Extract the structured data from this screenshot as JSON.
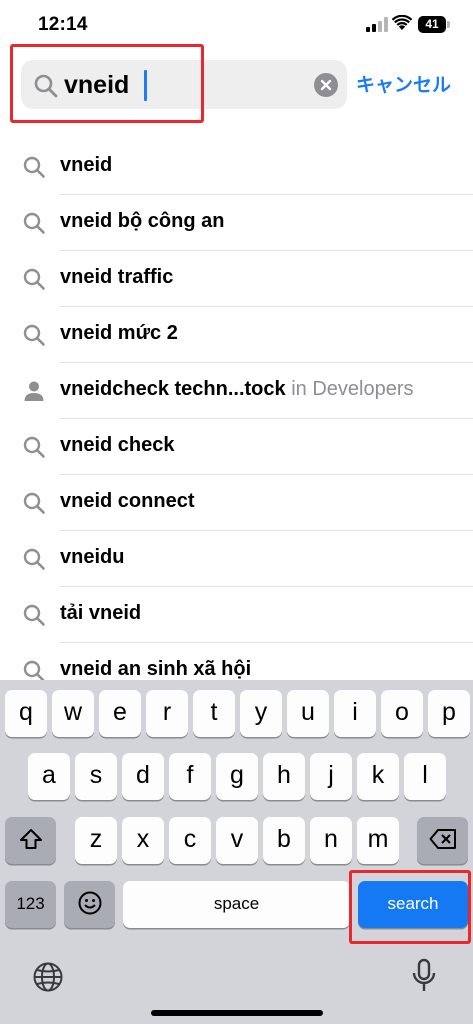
{
  "status_bar": {
    "time": "12:14",
    "battery": "41",
    "icons": [
      "signal-icon",
      "wifi-icon",
      "battery-icon"
    ]
  },
  "search": {
    "value": "vneid",
    "cancel_label": "キャンセル",
    "clear_icon": "clear-icon",
    "search_icon": "search-icon"
  },
  "suggestions": [
    {
      "icon": "search-icon",
      "text": "vneid",
      "suffix": ""
    },
    {
      "icon": "search-icon",
      "text": "vneid bộ công an",
      "suffix": ""
    },
    {
      "icon": "search-icon",
      "text": "vneid traffic",
      "suffix": ""
    },
    {
      "icon": "search-icon",
      "text": "vneid mức 2",
      "suffix": ""
    },
    {
      "icon": "person-icon",
      "text": "vneidcheck techn...tock",
      "suffix": " in Developers"
    },
    {
      "icon": "search-icon",
      "text": "vneid check",
      "suffix": ""
    },
    {
      "icon": "search-icon",
      "text": "vneid connect",
      "suffix": ""
    },
    {
      "icon": "search-icon",
      "text": "vneidu",
      "suffix": ""
    },
    {
      "icon": "search-icon",
      "text": "tải vneid",
      "suffix": ""
    },
    {
      "icon": "search-icon",
      "text": "vneid an sinh xã hội",
      "suffix": ""
    }
  ],
  "keyboard": {
    "row1": [
      "q",
      "w",
      "e",
      "r",
      "t",
      "y",
      "u",
      "i",
      "o",
      "p"
    ],
    "row2": [
      "a",
      "s",
      "d",
      "f",
      "g",
      "h",
      "j",
      "k",
      "l"
    ],
    "row3": [
      "z",
      "x",
      "c",
      "v",
      "b",
      "n",
      "m"
    ],
    "numbers_label": "123",
    "space_label": "space",
    "search_label": "search",
    "icons": [
      "shift-icon",
      "delete-icon",
      "emoji-icon",
      "globe-icon",
      "microphone-icon"
    ]
  },
  "colors": {
    "accent": "#1a7cf5",
    "highlight": "#e8282e",
    "keyboard_bg": "#d2d4da",
    "search_key": "#1679f4"
  }
}
